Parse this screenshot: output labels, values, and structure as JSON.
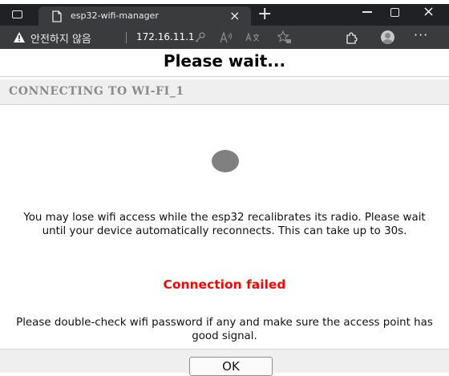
{
  "browser": {
    "tab": {
      "title": "esp32-wifi-manager",
      "close_glyph": "×"
    },
    "new_tab_glyph": "+",
    "window_controls": {
      "close_glyph": "×"
    },
    "address_bar": {
      "security_label": "안전하지 않음",
      "url": "172.16.11.1",
      "more_glyph": "···"
    },
    "icons": [
      "tab-switcher-icon",
      "page-icon",
      "warning-icon",
      "key-icon",
      "read-aloud-icon",
      "translate-icon",
      "favorite-icon",
      "extensions-icon",
      "profile-avatar",
      "more-icon"
    ]
  },
  "page": {
    "title": "Please wait...",
    "section_title": "CONNECTING TO WI-FI_1",
    "wait_message": "You may lose wifi access while the esp32 recalibrates its radio. Please wait until your device automatically reconnects. This can take up to 30s.",
    "fail_message": "Connection failed",
    "check_message": "Please double-check wifi password if any and make sure the access point has good signal.",
    "ok_button": "OK"
  },
  "colors": {
    "chrome_bg": "#202124",
    "addressbar_bg": "#3a3b3d",
    "error_red": "#ff0000",
    "section_bg": "#efefef",
    "spinner": "#808080"
  }
}
